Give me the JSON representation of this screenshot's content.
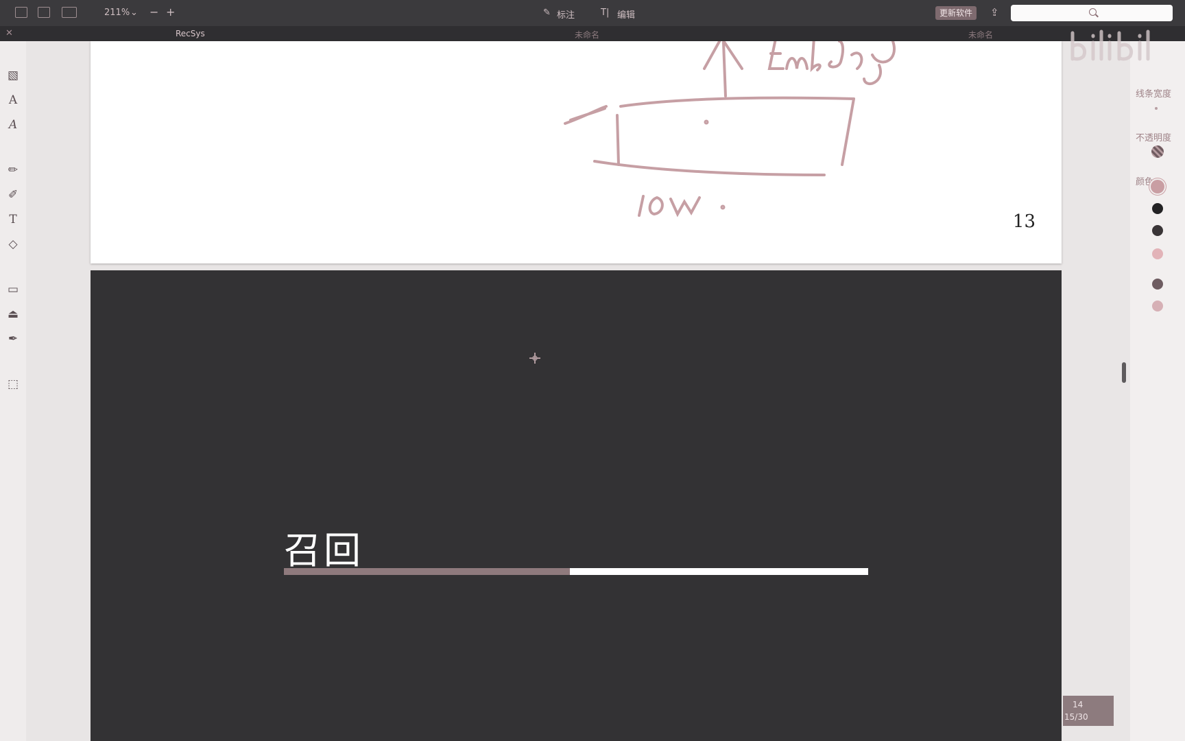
{
  "toolbar": {
    "zoom": "211%",
    "annotate_label": "标注",
    "edit_label": "编辑",
    "update_button": "更新软件",
    "search_placeholder": ""
  },
  "tabs": [
    {
      "label": "RecSys",
      "active": true
    },
    {
      "label": "未命名",
      "active": false
    },
    {
      "label": "未命名",
      "active": false
    }
  ],
  "page13": {
    "page_number": "13",
    "handwriting": [
      "Embedding.",
      "10W."
    ]
  },
  "page14": {
    "title": "召回",
    "progress": 0.49
  },
  "right_panel": {
    "stroke_width_label": "线条宽度",
    "opacity_label": "不透明度",
    "color_label": "颜色",
    "colors": [
      "#c99ea3",
      "#232224",
      "#3a3537",
      "#e2b3b8",
      "#6e5c61",
      "#d6b0b5"
    ]
  },
  "page_indicator": {
    "current": "14",
    "position": "15/30"
  }
}
